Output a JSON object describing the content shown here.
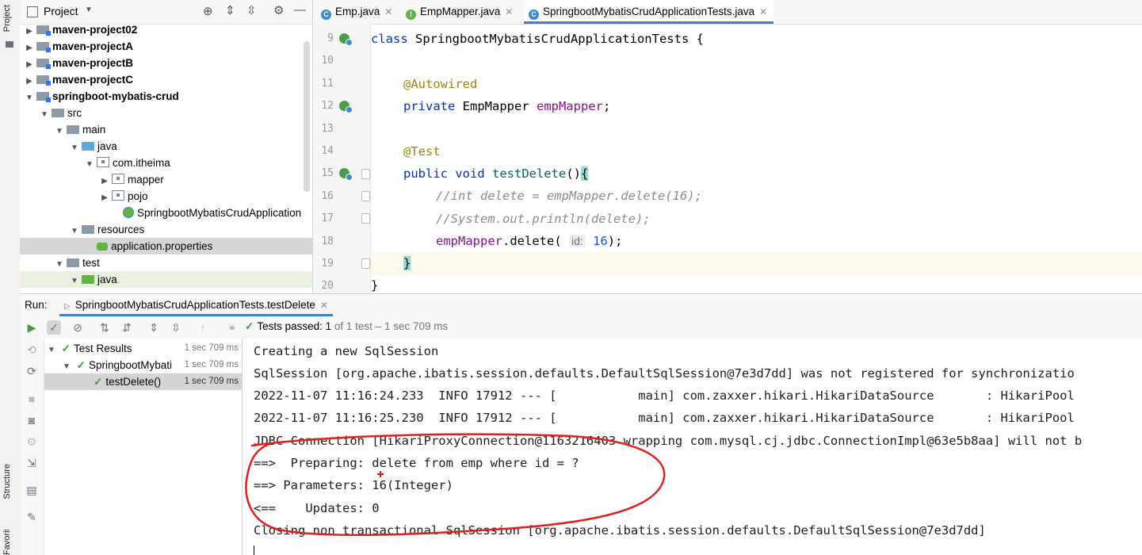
{
  "left_strip": {
    "project_tab": "Project",
    "structure_tab": "Structure",
    "favorites_tab": "Favorites"
  },
  "project_panel": {
    "title": "Project",
    "tree": [
      {
        "label": "maven-project02",
        "bold": true
      },
      {
        "label": "maven-projectA",
        "bold": true
      },
      {
        "label": "maven-projectB",
        "bold": true
      },
      {
        "label": "maven-projectC",
        "bold": true
      },
      {
        "label": "springboot-mybatis-crud",
        "bold": true
      },
      {
        "label": "src"
      },
      {
        "label": "main"
      },
      {
        "label": "java"
      },
      {
        "label": "com.itheima"
      },
      {
        "label": "mapper"
      },
      {
        "label": "pojo"
      },
      {
        "label": "SpringbootMybatisCrudApplication"
      },
      {
        "label": "resources"
      },
      {
        "label": "application.properties"
      },
      {
        "label": "test"
      },
      {
        "label": "java"
      }
    ]
  },
  "editor": {
    "tabs": [
      {
        "label": "Emp.java"
      },
      {
        "label": "EmpMapper.java"
      },
      {
        "label": "SpringbootMybatisCrudApplicationTests.java"
      }
    ],
    "line_numbers": [
      "9",
      "10",
      "11",
      "12",
      "13",
      "14",
      "15",
      "16",
      "17",
      "18",
      "19",
      "20"
    ],
    "code": {
      "l9_kw": "class",
      "l9_rest": " SpringbootMybatisCrudApplicationTests {",
      "l11_ann": "@Autowired",
      "l12_kw": "private",
      "l12_type": " EmpMapper ",
      "l12_field": "empMapper",
      "l12_end": ";",
      "l14_ann": "@Test",
      "l15_kw": "public void",
      "l15_name": " testDelete",
      "l15_parens": "()",
      "l15_brace": "{",
      "l16_cmt": "//int delete = empMapper.delete(16);",
      "l17_cmt": "//System.out.println(delete);",
      "l18_field": "empMapper",
      "l18_call": ".delete( ",
      "l18_hint": "id:",
      "l18_num": " 16",
      "l18_end": ");",
      "l19_brace": "}",
      "l20_brace": "}"
    }
  },
  "run_panel": {
    "label": "Run:",
    "tab": "SpringbootMybatisCrudApplicationTests.testDelete",
    "status_label": "Tests passed:",
    "status_count": "1",
    "status_detail": "of 1 test – 1 sec 709 ms",
    "results": [
      {
        "label": "Test Results",
        "time": "1 sec 709 ms"
      },
      {
        "label": "SpringbootMybati",
        "time": "1 sec 709 ms"
      },
      {
        "label": "testDelete()",
        "time": "1 sec 709 ms"
      }
    ],
    "console": [
      "Creating a new SqlSession",
      "SqlSession [org.apache.ibatis.session.defaults.DefaultSqlSession@7e3d7dd] was not registered for synchronizatio",
      "2022-11-07 11:16:24.233  INFO 17912 --- [           main] com.zaxxer.hikari.HikariDataSource       : HikariPool",
      "2022-11-07 11:16:25.230  INFO 17912 --- [           main] com.zaxxer.hikari.HikariDataSource       : HikariPool",
      "JDBC Connection [HikariProxyConnection@1163216403 wrapping com.mysql.cj.jdbc.ConnectionImpl@63e5b8aa] will not b",
      "==>  Preparing: delete from emp where id = ?",
      "==> Parameters: 16(Integer)",
      "<==    Updates: 0",
      "Closing non transactional SqlSession [org.apache.ibatis.session.defaults.DefaultSqlSession@7e3d7dd]"
    ]
  },
  "colors": {
    "annotation_ring": "#e0201a",
    "pass_green": "#3f9a3f",
    "active_tab": "#4083c9"
  }
}
